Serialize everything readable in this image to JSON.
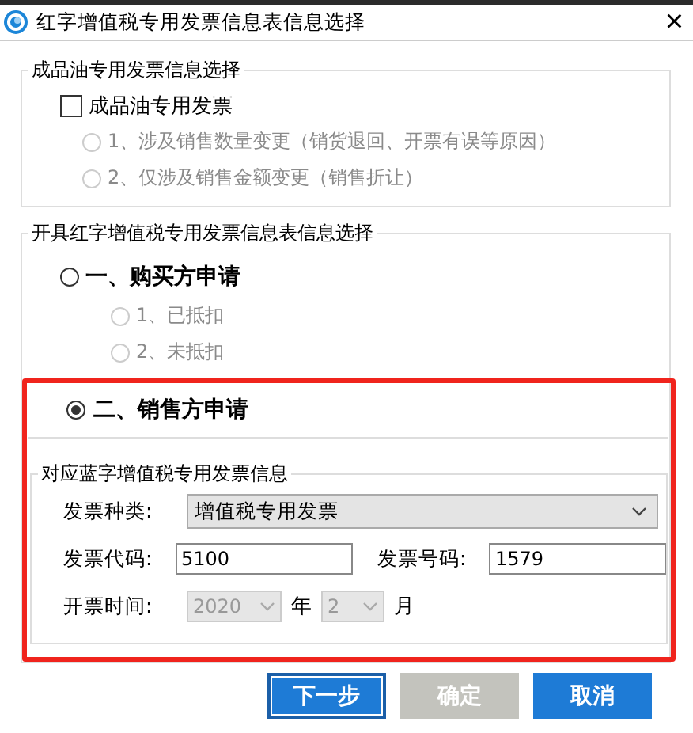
{
  "window": {
    "title": "红字增值税专用发票信息表信息选择",
    "close": "×"
  },
  "oil_group": {
    "legend": "成品油专用发票信息选择",
    "checkbox": {
      "label": "成品油专用发票",
      "checked": false
    },
    "options": [
      {
        "label": "1、涉及销售数量变更（销货退回、开票有误等原因）",
        "selected": false,
        "disabled": true
      },
      {
        "label": "2、仅涉及销售金额变更（销售折让）",
        "selected": false,
        "disabled": true
      }
    ]
  },
  "issue_group": {
    "legend": "开具红字增值税专用发票信息表信息选择",
    "buyer": {
      "label": "一、购买方申请",
      "selected": false,
      "options": [
        {
          "label": "1、已抵扣",
          "selected": false,
          "disabled": true
        },
        {
          "label": "2、未抵扣",
          "selected": false,
          "disabled": true
        }
      ]
    },
    "seller": {
      "label": "二、销售方申请",
      "selected": true,
      "highlighted": true,
      "invoice_info": {
        "legend": "对应蓝字增值税专用发票信息",
        "type_label": "发票种类:",
        "type_value": "增值税专用发票",
        "code_label": "发票代码:",
        "code_value": "5100",
        "number_label": "发票号码:",
        "number_value": "1579",
        "date_label": "开票时间:",
        "year": "2020",
        "year_unit": "年",
        "month": "2",
        "month_unit": "月",
        "date_disabled": true
      }
    }
  },
  "buttons": [
    {
      "label": "下一步",
      "kind": "focused"
    },
    {
      "label": "确定",
      "kind": "disabled"
    },
    {
      "label": "取消",
      "kind": "primary"
    }
  ]
}
